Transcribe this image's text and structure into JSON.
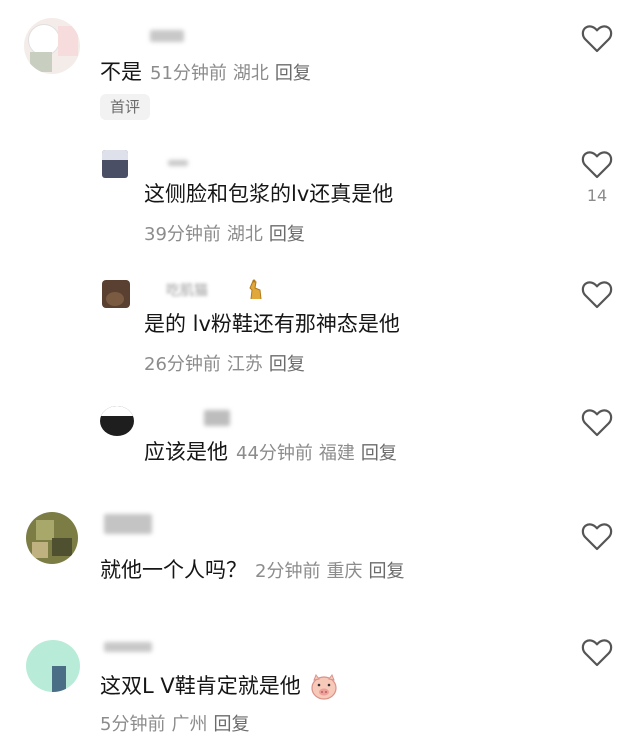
{
  "comments": [
    {
      "text": "不是",
      "time": "51分钟前",
      "location": "湖北",
      "reply": "回复",
      "tag": "首评",
      "likes": ""
    },
    {
      "text": "这侧脸和包浆的lv还真是他",
      "time": "39分钟前",
      "location": "湖北",
      "reply": "回复",
      "likes": "14"
    },
    {
      "name": "吃肌猫",
      "text": "是的 lv粉鞋还有那神态是他",
      "time": "26分钟前",
      "location": "江苏",
      "reply": "回复",
      "likes": ""
    },
    {
      "text": "应该是他",
      "time": "44分钟前",
      "location": "福建",
      "reply": "回复",
      "likes": ""
    },
    {
      "text": "就他一个人吗？",
      "time": "2分钟前",
      "location": "重庆",
      "reply": "回复",
      "likes": ""
    },
    {
      "text": "这双L V鞋肯定就是他",
      "time": "5分钟前",
      "location": "广州",
      "reply": "回复",
      "likes": ""
    }
  ],
  "icons": {
    "like": "heart-outline-icon",
    "name_badge": "giraffe-emoji-icon",
    "text_emoji": "pig-face-emoji-icon"
  },
  "colors": {
    "text": "#161616",
    "meta": "#8c8c8c",
    "heart": "#555555",
    "tag_bg": "#f2f2f2"
  }
}
